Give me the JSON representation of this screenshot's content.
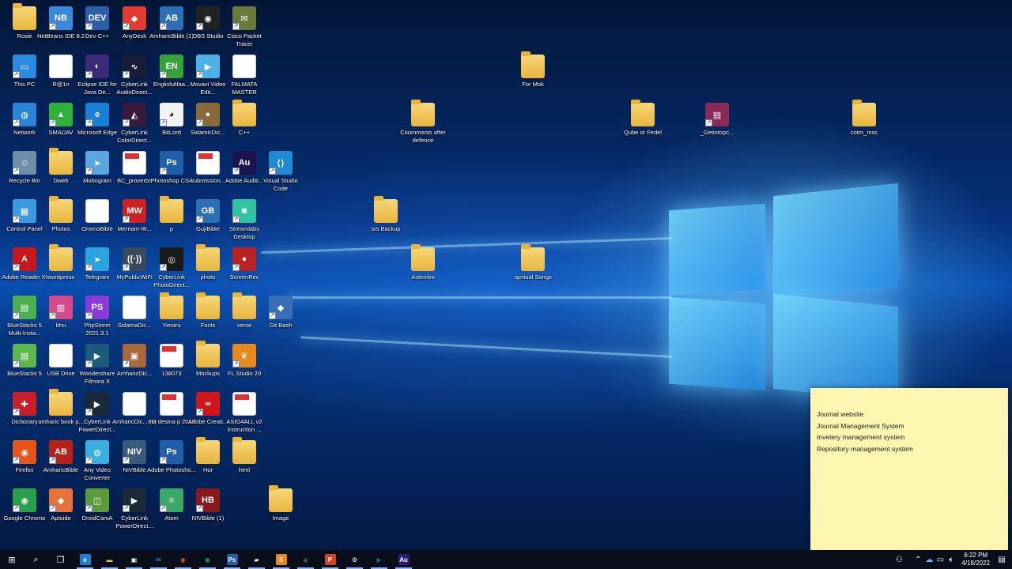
{
  "desktop_icons": [
    {
      "label": "Rosie",
      "kind": "folder"
    },
    {
      "label": "NetBeans IDE 8.2",
      "kind": "app",
      "color": "#3a88d8",
      "text": "NB"
    },
    {
      "label": "Dev-C++",
      "kind": "app",
      "color": "#2d5fa8",
      "text": "DEV"
    },
    {
      "label": "AnyDesk",
      "kind": "app",
      "color": "#e33b32",
      "text": "◆"
    },
    {
      "label": "AmharicBible (1)",
      "kind": "app",
      "color": "#2c6fb5",
      "text": "AB"
    },
    {
      "label": "OBS Studio",
      "kind": "app",
      "color": "#222222",
      "text": "◉"
    },
    {
      "label": "Cisco Packet Tracer",
      "kind": "app",
      "color": "#6a7a3a",
      "text": "✉"
    },
    {
      "label": "This PC",
      "kind": "app",
      "color": "#2b8be0",
      "text": "▭"
    },
    {
      "label": "R@1n",
      "kind": "file"
    },
    {
      "label": "Eclipse IDE for Java De...",
      "kind": "app",
      "color": "#3b2a78",
      "text": "◐"
    },
    {
      "label": "CyberLink AudioDirect...",
      "kind": "app",
      "color": "#1a1a3a",
      "text": "∿"
    },
    {
      "label": "EnglishAfaa...",
      "kind": "app",
      "color": "#35a23a",
      "text": "EN"
    },
    {
      "label": "Movavi Video Edit...",
      "kind": "app",
      "color": "#4bb2e6",
      "text": "▶"
    },
    {
      "label": "FALMATA MASTER",
      "kind": "file"
    },
    {
      "label": "Network",
      "kind": "app",
      "color": "#2a84d8",
      "text": "◍"
    },
    {
      "label": "SMADAV",
      "kind": "app",
      "color": "#2fb13a",
      "text": "▲"
    },
    {
      "label": "Microsoft Edge",
      "kind": "app",
      "color": "#1a7fd6",
      "text": "e"
    },
    {
      "label": "CyberLink ColorDirect...",
      "kind": "app",
      "color": "#3a1a3a",
      "text": "◭"
    },
    {
      "label": "BitLord",
      "kind": "app",
      "color": "#f2f2f2",
      "text": "◕"
    },
    {
      "label": "SidamicDic...",
      "kind": "app",
      "color": "#8a6a3a",
      "text": "●"
    },
    {
      "label": "C++",
      "kind": "folder"
    },
    {
      "label": "Recycle Bin",
      "kind": "app",
      "color": "#6f8fa8",
      "text": "♲"
    },
    {
      "label": "Dweb",
      "kind": "folder"
    },
    {
      "label": "Mobogram",
      "kind": "app",
      "color": "#5aa7e0",
      "text": "➤"
    },
    {
      "label": "BC_proverbs",
      "kind": "pdf"
    },
    {
      "label": "Photoshop CS4",
      "kind": "app",
      "color": "#1e5fa8",
      "text": "Ps"
    },
    {
      "label": "submission...",
      "kind": "pdf"
    },
    {
      "label": "Adobe Auditi...",
      "kind": "app",
      "color": "#1a1450",
      "text": "Au"
    },
    {
      "label": "Visual Studio Code",
      "kind": "app",
      "color": "#1f8ad2",
      "text": "⟨⟩"
    },
    {
      "label": "Control Panel",
      "kind": "app",
      "color": "#3c9be0",
      "text": "▦"
    },
    {
      "label": "Photos",
      "kind": "folder"
    },
    {
      "label": "OromoBible",
      "kind": "file"
    },
    {
      "label": "Merriam-W...",
      "kind": "app",
      "color": "#c22",
      "text": "MW"
    },
    {
      "label": "p",
      "kind": "folder"
    },
    {
      "label": "GujiBible",
      "kind": "app",
      "color": "#2c6fb5",
      "text": "GB"
    },
    {
      "label": "Streamlabs Desktop",
      "kind": "app",
      "color": "#31c3a2",
      "text": "◙"
    },
    {
      "label": "Adobe Reader XI",
      "kind": "app",
      "color": "#c8161d",
      "text": "A"
    },
    {
      "label": "wordpress",
      "kind": "folder"
    },
    {
      "label": "Telegram",
      "kind": "app",
      "color": "#2aa3e0",
      "text": "➤"
    },
    {
      "label": "MyPublicWiFi",
      "kind": "app",
      "color": "#3a4a5a",
      "text": "((·))"
    },
    {
      "label": "CyberLink PhotoDirect...",
      "kind": "app",
      "color": "#1a1a1a",
      "text": "◎"
    },
    {
      "label": "photo",
      "kind": "folder"
    },
    {
      "label": "ScreenRec",
      "kind": "app",
      "color": "#b22",
      "text": "●"
    },
    {
      "label": "BlueStacks 5 Multi-Insta...",
      "kind": "app",
      "color": "#4caf50",
      "text": "▤"
    },
    {
      "label": "bhu",
      "kind": "app",
      "color": "#d44a8a",
      "text": "▥"
    },
    {
      "label": "PhpStorm 2021.3.1",
      "kind": "app",
      "color": "#8a3ad8",
      "text": "PS"
    },
    {
      "label": "SidamaDic...",
      "kind": "file"
    },
    {
      "label": "Yimaru",
      "kind": "folder"
    },
    {
      "label": "Fonts",
      "kind": "folder"
    },
    {
      "label": "verse",
      "kind": "folder"
    },
    {
      "label": "Git Bash",
      "kind": "app",
      "color": "#3a6fb8",
      "text": "◆"
    },
    {
      "label": "BlueStacks 5",
      "kind": "app",
      "color": "#5cb84a",
      "text": "▤"
    },
    {
      "label": "USB Drive",
      "kind": "file"
    },
    {
      "label": "Wondershare Filmora X",
      "kind": "app",
      "color": "#1a5a7a",
      "text": "▶"
    },
    {
      "label": "AmharicDic...",
      "kind": "app",
      "color": "#a8683a",
      "text": "▣"
    },
    {
      "label": "138073",
      "kind": "pdf"
    },
    {
      "label": "Mockups",
      "kind": "folder"
    },
    {
      "label": "FL Studio 20",
      "kind": "app",
      "color": "#e88a1a",
      "text": "❦"
    },
    {
      "label": "Dictionary",
      "kind": "app",
      "color": "#c8202a",
      "text": "✚"
    },
    {
      "label": "amharic book p...",
      "kind": "folder"
    },
    {
      "label": "CyberLink PowerDirect...",
      "kind": "app",
      "color": "#1a2a3a",
      "text": "▶"
    },
    {
      "label": "AmharicDic... (1)",
      "kind": "file"
    },
    {
      "label": "ma desina p 2013",
      "kind": "pdf"
    },
    {
      "label": "Adobe Creati...",
      "kind": "app",
      "color": "#d0151b",
      "text": "∞"
    },
    {
      "label": "ASIO4ALL v2 Instruction ...",
      "kind": "pdf"
    },
    {
      "label": "Firefox",
      "kind": "app",
      "color": "#e8541a",
      "text": "◉"
    },
    {
      "label": "AmharicBible",
      "kind": "app",
      "color": "#b8201a",
      "text": "AB"
    },
    {
      "label": "Any Video Converter",
      "kind": "app",
      "color": "#3ab0e0",
      "text": "◍"
    },
    {
      "label": "NIVBible",
      "kind": "app",
      "color": "#3a5a7a",
      "text": "NIV"
    },
    {
      "label": "Adobe Photosho...",
      "kind": "app",
      "color": "#1e5fa8",
      "text": "Ps"
    },
    {
      "label": "Hor",
      "kind": "folder"
    },
    {
      "label": "html",
      "kind": "folder"
    },
    {
      "label": "Google Chrome",
      "kind": "app",
      "color": "#2aa04a",
      "text": "◉"
    },
    {
      "label": "Aptoide",
      "kind": "app",
      "color": "#e8703a",
      "text": "◆"
    },
    {
      "label": "DroidCamA",
      "kind": "app",
      "color": "#5a9a3a",
      "text": "◫"
    },
    {
      "label": "CyberLink PowerDirect...",
      "kind": "app",
      "color": "#1a2a3a",
      "text": "▶"
    },
    {
      "label": "Atom",
      "kind": "app",
      "color": "#3aa86a",
      "text": "⚛"
    },
    {
      "label": "NIVBible (1)",
      "kind": "app",
      "color": "#8a1a1a",
      "text": "HB"
    },
    {
      "label": "Image",
      "kind": "folder"
    },
    {
      "label": "For Mok",
      "kind": "folder"
    },
    {
      "label": "Coomments after defence",
      "kind": "folder"
    },
    {
      "label": "Qube or Fedel",
      "kind": "folder"
    },
    {
      "label": "_Getintopc...",
      "kind": "app",
      "color": "#8a2a5a",
      "text": "▤"
    },
    {
      "label": "cotm_msc",
      "kind": "folder"
    },
    {
      "label": "srs Backup",
      "kind": "folder"
    },
    {
      "label": "Astemiro",
      "kind": "folder"
    },
    {
      "label": "spritual Songs",
      "kind": "folder"
    }
  ],
  "sticky_note": {
    "lines": [
      "Journal website",
      "Journal Management System",
      "Invetery management system",
      "Repository management system"
    ]
  },
  "taskbar": {
    "items": [
      {
        "name": "start-button",
        "glyph": "⊞"
      },
      {
        "name": "search-button",
        "glyph": "⌕"
      },
      {
        "name": "task-view-button",
        "glyph": "❐"
      },
      {
        "name": "taskbar-edge",
        "glyph": "e",
        "color": "#1a7fd6"
      },
      {
        "name": "taskbar-file-explorer",
        "glyph": "▬",
        "color": "#e8b53c"
      },
      {
        "name": "taskbar-store",
        "glyph": "▣",
        "color": "#ffffff"
      },
      {
        "name": "taskbar-mail",
        "glyph": "✉",
        "color": "#3a8ad8"
      },
      {
        "name": "taskbar-firefox",
        "glyph": "◉",
        "color": "#e8541a"
      },
      {
        "name": "taskbar-chrome",
        "glyph": "◉",
        "color": "#2aa04a"
      },
      {
        "name": "taskbar-photoshop",
        "glyph": "Ps",
        "color": "#1e5fa8"
      },
      {
        "name": "taskbar-app-white",
        "glyph": "▰",
        "color": "#ffffff"
      },
      {
        "name": "taskbar-sublime",
        "glyph": "S",
        "color": "#e8871a"
      },
      {
        "name": "taskbar-obs",
        "glyph": "◉",
        "color": "#555555"
      },
      {
        "name": "taskbar-powerpoint",
        "glyph": "P",
        "color": "#d04423"
      },
      {
        "name": "taskbar-settings",
        "glyph": "⚙",
        "color": "#ffffff"
      },
      {
        "name": "taskbar-powerdirector",
        "glyph": "▶",
        "color": "#1a6a8a"
      },
      {
        "name": "taskbar-audition",
        "glyph": "Au",
        "color": "#2a1a7a"
      }
    ],
    "time": "6:22 PM",
    "date": "4/18/2022"
  }
}
